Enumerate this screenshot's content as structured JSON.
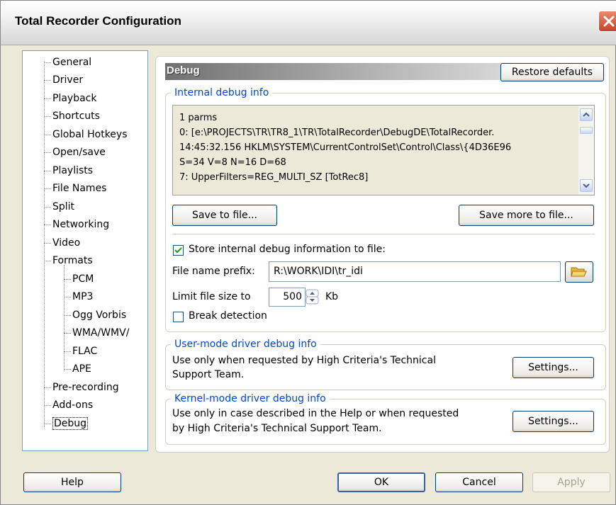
{
  "window": {
    "title": "Total Recorder Configuration"
  },
  "tree": {
    "items": [
      {
        "label": "General"
      },
      {
        "label": "Driver"
      },
      {
        "label": "Playback"
      },
      {
        "label": "Shortcuts"
      },
      {
        "label": "Global Hotkeys"
      },
      {
        "label": "Open/save"
      },
      {
        "label": "Playlists"
      },
      {
        "label": "File Names"
      },
      {
        "label": "Split"
      },
      {
        "label": "Networking"
      },
      {
        "label": "Video"
      },
      {
        "label": "Formats"
      },
      {
        "label": "PCM"
      },
      {
        "label": "MP3"
      },
      {
        "label": "Ogg Vorbis"
      },
      {
        "label": "WMA/WMV/"
      },
      {
        "label": "FLAC"
      },
      {
        "label": "APE"
      },
      {
        "label": "Pre-recording"
      },
      {
        "label": "Add-ons"
      },
      {
        "label": "Debug"
      }
    ],
    "selected": "Debug"
  },
  "header": {
    "title": "Debug",
    "restore_label": "Restore defaults"
  },
  "internal": {
    "group_title": "Internal debug info",
    "lines": [
      "1 parms",
      "0: [e:\\PROJECTS\\TR\\TR8_1\\TR\\TotalRecorder\\DebugDE\\TotalRecorder.",
      "14:45:32.156 HKLM\\SYSTEM\\CurrentControlSet\\Control\\Class\\{4D36E96",
      "S=34 V=8 N=16 D=68",
      "7: UpperFilters=REG_MULTI_SZ [TotRec8]"
    ],
    "save_label": "Save to file...",
    "save_more_label": "Save more to file...",
    "store_label": "Store internal debug information to file:",
    "store_checked": true,
    "prefix_label": "File name prefix:",
    "prefix_value": "R:\\WORK\\IDI\\tr_idi",
    "limit_label": "Limit file size to",
    "limit_value": "500",
    "limit_unit": "Kb",
    "break_label": "Break detection",
    "break_checked": false
  },
  "user_mode": {
    "group_title": "User-mode driver debug info",
    "text_line1": "Use only when requested by High Criteria's Technical",
    "text_line2": "Support Team.",
    "settings_label": "Settings..."
  },
  "kernel_mode": {
    "group_title": "Kernel-mode driver debug info",
    "text_line1": "Use only in case described in the Help or when requested",
    "text_line2": "by High Criteria's Technical Support Team.",
    "settings_label": "Settings..."
  },
  "footer": {
    "help_label": "Help",
    "ok_label": "OK",
    "cancel_label": "Cancel",
    "apply_label": "Apply"
  },
  "colors": {
    "group_title": "#0046d5",
    "window_bg": "#ece9d8",
    "close_button": "#c8432a"
  }
}
